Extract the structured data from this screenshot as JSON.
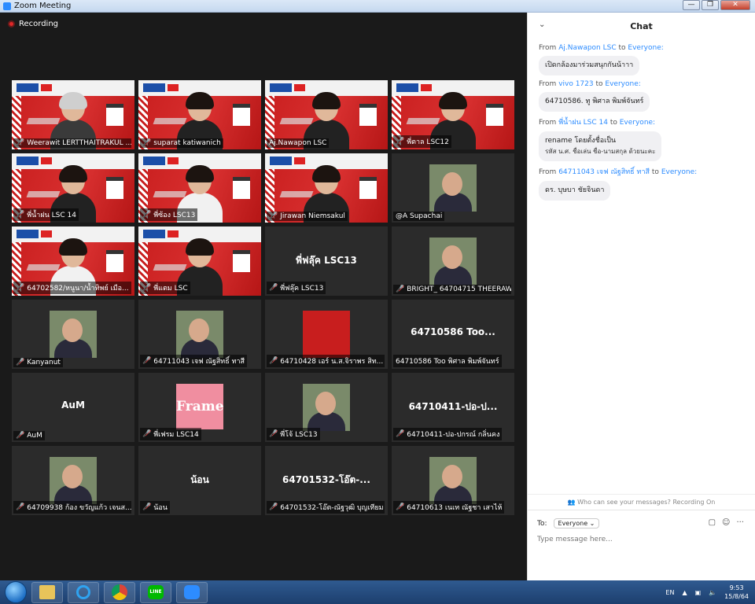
{
  "window": {
    "title": "Zoom Meeting",
    "minimize": "—",
    "maximize": "❐",
    "close": "✕"
  },
  "recording": {
    "label": "Recording"
  },
  "tiles": [
    {
      "name": "Weerawit LERTTHAITRAKUL ...",
      "kind": "poster",
      "person": "grey",
      "muted": true
    },
    {
      "name": "suparat katiwanich",
      "kind": "poster",
      "person": "dark",
      "muted": true
    },
    {
      "name": "Aj.Nawapon LSC",
      "kind": "poster",
      "person": "dark",
      "muted": false,
      "active": true
    },
    {
      "name": "พี่ตาล LSC12",
      "kind": "poster",
      "person": "dark",
      "muted": true
    },
    {
      "name": "พี่น้ำฝน LSC 14",
      "kind": "poster",
      "person": "dark",
      "muted": true
    },
    {
      "name": "พี่ซ้อง LSC13",
      "kind": "poster",
      "person": "white",
      "muted": true
    },
    {
      "name": "Jirawan Niemsakul",
      "kind": "poster",
      "person": "dark",
      "muted": true
    },
    {
      "name": "@A Supachai",
      "kind": "thumb",
      "muted": false
    },
    {
      "name": "64702582/หนูนา/น้ำทิพย์ เมือ...",
      "kind": "poster",
      "person": "white",
      "muted": true
    },
    {
      "name": "พี่แตม LSC",
      "kind": "poster",
      "person": "dark",
      "muted": true
    },
    {
      "name": "พี่ฟลุ๊ค LSC13",
      "kind": "text",
      "big": "พี่ฟลุ๊ค LSC13",
      "muted": true
    },
    {
      "name": "BRIGHT_ 64704715 THEERAW...",
      "kind": "thumb",
      "muted": true
    },
    {
      "name": "Kanyanut",
      "kind": "thumb",
      "muted": true
    },
    {
      "name": "64711043 เจฟ ณัฐสิทธิ์ ทาสี",
      "kind": "thumb",
      "muted": true
    },
    {
      "name": "64710428 เอร์ น.ส.จิราพร สิท...",
      "kind": "smallposter",
      "muted": true
    },
    {
      "name": "64710586  Too  พิศาล  พิมพ์จันทร์",
      "kind": "text",
      "big": "64710586  Too...",
      "muted": false
    },
    {
      "name": "AuM",
      "kind": "text",
      "big": "AuM",
      "muted": true
    },
    {
      "name": "พี่เฟรม LSC14",
      "kind": "frame",
      "frame_text": "Frame",
      "muted": true
    },
    {
      "name": "พี่โจ้  LSC13",
      "kind": "thumb",
      "muted": true
    },
    {
      "name": "64710411-ปอ-ปกรณ์ กลิ่นคง",
      "kind": "text",
      "big": "64710411-ปอ-ป...",
      "muted": true
    },
    {
      "name": "64709938 ก้อง ขวัญแก้ว เจนส...",
      "kind": "thumb",
      "muted": true
    },
    {
      "name": "น้อน",
      "kind": "text",
      "big": "น้อน",
      "muted": true
    },
    {
      "name": "64701532-โอ๊ต-ณัฐวุฒิ บุญเทียม",
      "kind": "text",
      "big": "64701532-โอ๊ต-...",
      "muted": true
    },
    {
      "name": "64710613 เนเท ณัฐชา เสาไห้",
      "kind": "thumb",
      "muted": true
    }
  ],
  "chat": {
    "title": "Chat",
    "collapse_icon": "⌄",
    "messages": [
      {
        "from": "From",
        "sender": "Aj.Nawapon LSC",
        "to": "to",
        "recipient": "Everyone:",
        "text": "เปิดกล้องมาร่วมสนุกกันน้าาา",
        "text2": ""
      },
      {
        "from": "From",
        "sender": "vivo 1723",
        "to": "to",
        "recipient": "Everyone:",
        "text": "64710586. ทู พิศาล พิมพ์จันทร์",
        "text2": ""
      },
      {
        "from": "From",
        "sender": "พี่น้ำฝน LSC 14",
        "to": "to",
        "recipient": "Everyone:",
        "text": "rename โดยตั้งชื่อเป็น",
        "text2": "รหัส น.ศ. ชื่อเล่น ชื่อ-นามสกุล ด้วยนะคะ"
      },
      {
        "from": "From",
        "sender": "64711043 เจฟ ณัฐสิทธิ์ ทาสี",
        "to": "to",
        "recipient": "Everyone:",
        "text": "ดร. บุษบา ชัยจินดา",
        "text2": ""
      }
    ],
    "privacy": "Who can see your messages? Recording On",
    "to_label": "To:",
    "to_value": "Everyone",
    "placeholder": "Type message here..."
  },
  "taskbar": {
    "line_label": "LINE",
    "lang": "EN",
    "time": "9:53",
    "date": "15/8/64"
  }
}
